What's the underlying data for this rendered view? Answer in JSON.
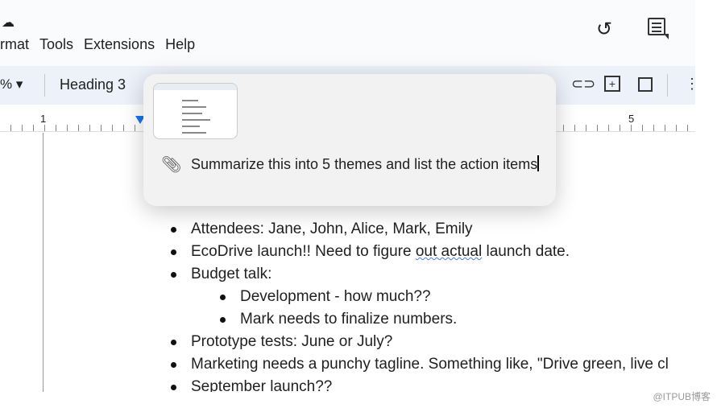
{
  "menu": {
    "items": [
      "rmat",
      "Tools",
      "Extensions",
      "Help"
    ]
  },
  "toolbar": {
    "zoom_fragment": "% ▾",
    "style": "Heading 3"
  },
  "ruler": {
    "marks": [
      "1",
      "5"
    ]
  },
  "popup": {
    "prompt": "Summarize this into 5 themes and list the action items"
  },
  "doc": {
    "items": [
      {
        "text": "Attendees: Jane, John, Alice, Mark, Emily",
        "level": 1
      },
      {
        "text_a": "EcoDrive launch!! Need to figure ",
        "text_b": "out actual",
        "text_c": " launch date.",
        "level": 1
      },
      {
        "text": "Budget talk:",
        "level": 1
      },
      {
        "text": "Development - how much??",
        "level": 2
      },
      {
        "text": "Mark needs to finalize numbers.",
        "level": 2
      },
      {
        "text": "Prototype tests: June or July?",
        "level": 1
      },
      {
        "text": "Marketing needs a punchy tagline. Something like, \"Drive green, live cl",
        "level": 1
      },
      {
        "text": "September launch??",
        "level": 1
      }
    ]
  },
  "watermark": "@ITPUB博客"
}
